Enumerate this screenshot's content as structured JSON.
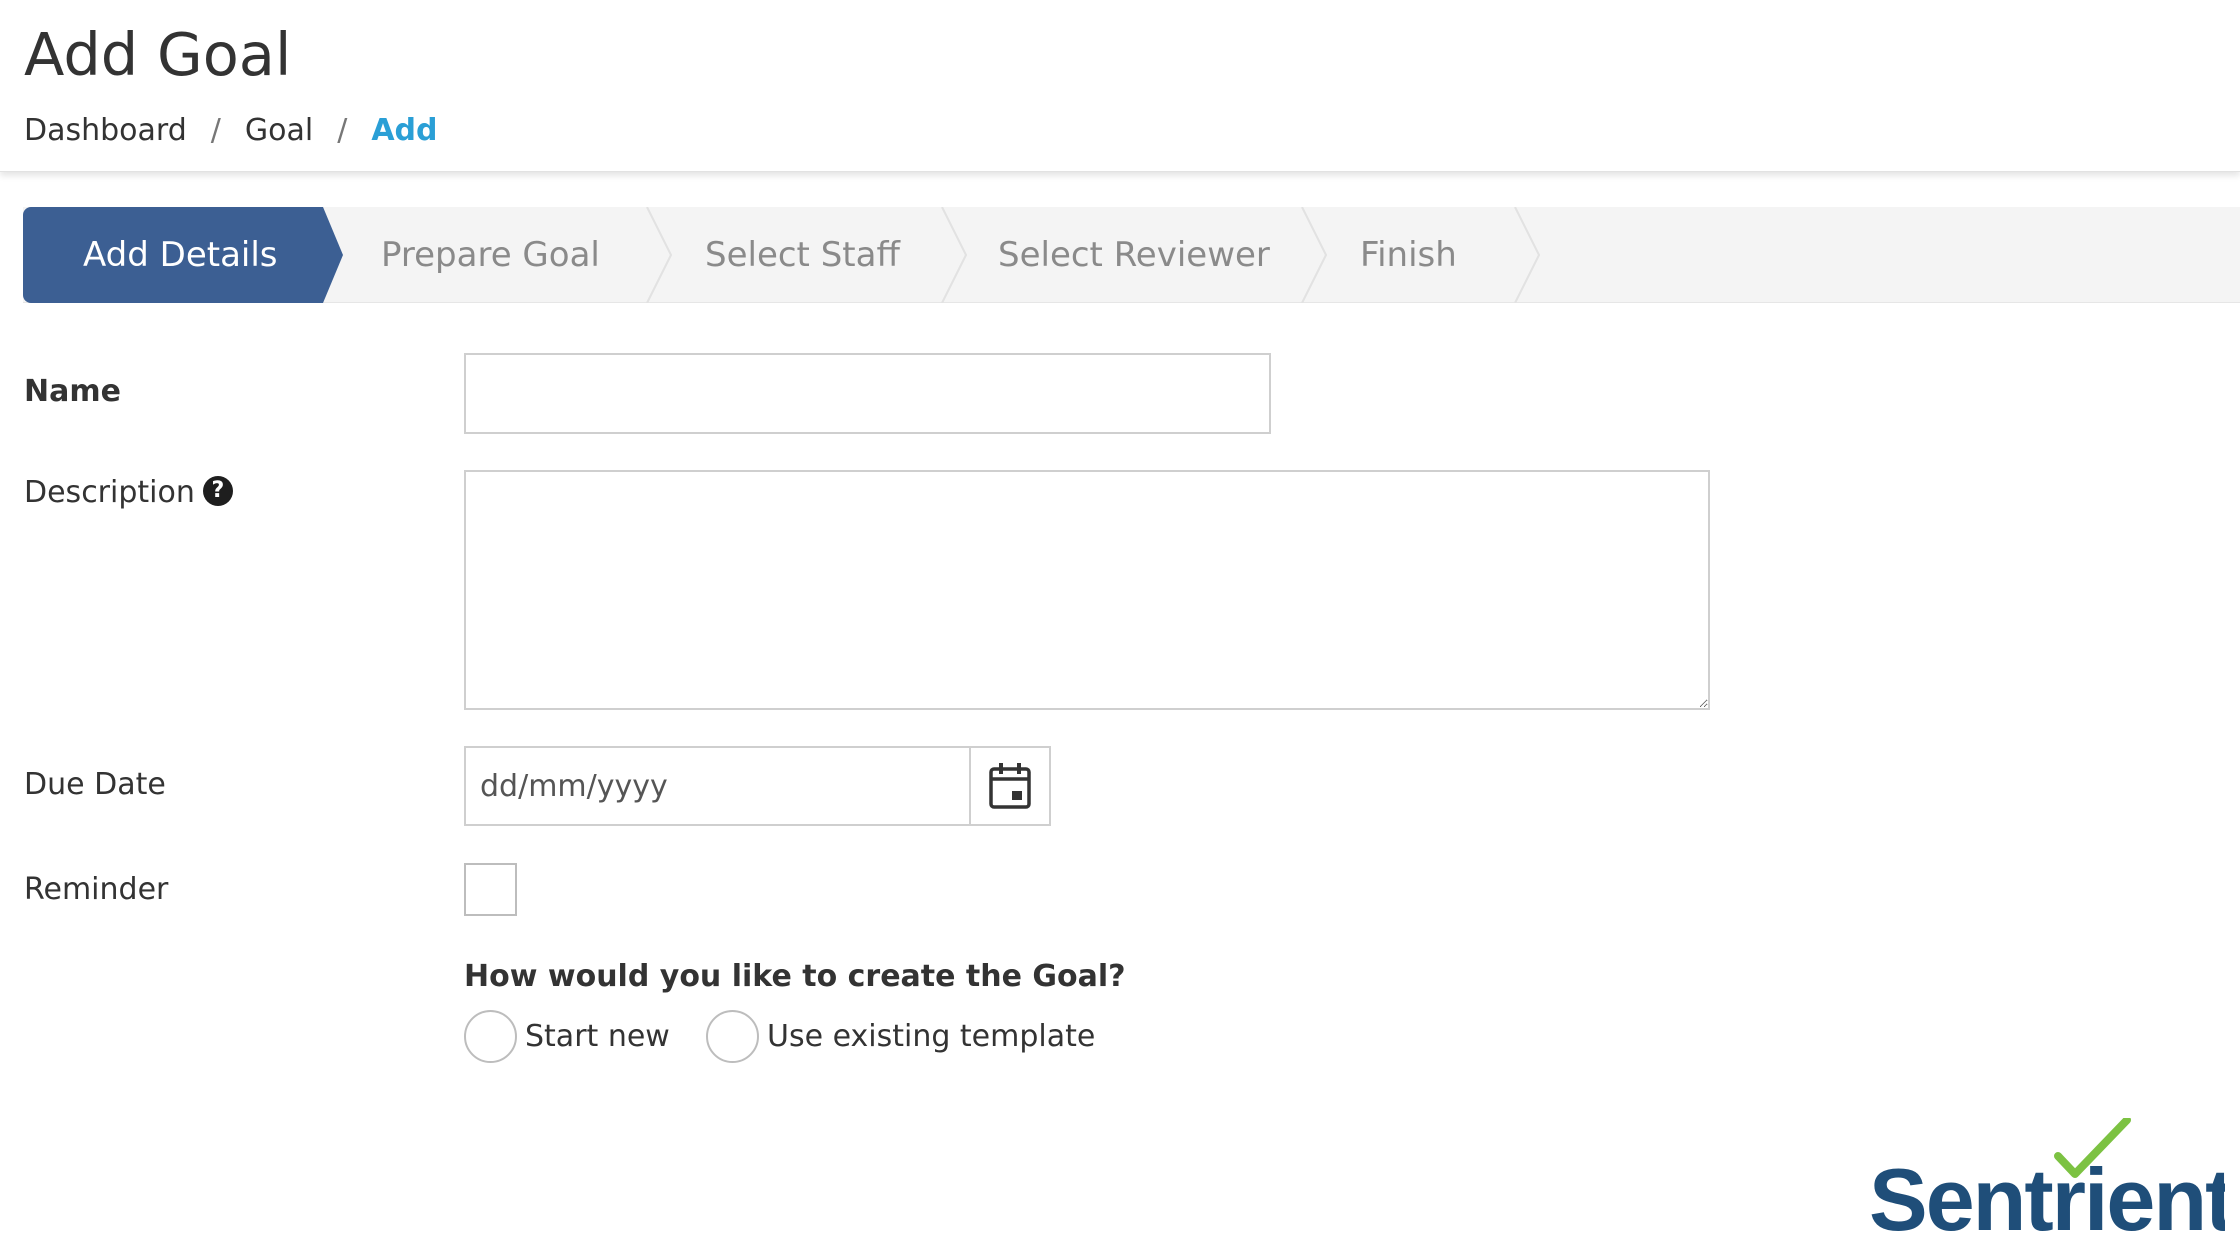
{
  "header": {
    "title": "Add Goal",
    "breadcrumb": [
      {
        "label": "Dashboard"
      },
      {
        "label": "Goal"
      },
      {
        "label": "Add"
      }
    ],
    "separator": "/"
  },
  "wizard": {
    "active_index": 0,
    "steps": [
      {
        "label": "Add Details"
      },
      {
        "label": "Prepare Goal"
      },
      {
        "label": "Select Staff"
      },
      {
        "label": "Select Reviewer"
      },
      {
        "label": "Finish"
      }
    ]
  },
  "form": {
    "name": {
      "label": "Name",
      "value": ""
    },
    "description": {
      "label": "Description",
      "help_icon": "?",
      "value": ""
    },
    "due_date": {
      "label": "Due Date",
      "placeholder": "dd/mm/yyyy",
      "value": ""
    },
    "reminder": {
      "label": "Reminder",
      "checked": false
    },
    "create_method": {
      "question": "How would you like to create the Goal?",
      "options": [
        {
          "label": "Start new",
          "selected": false
        },
        {
          "label": "Use existing template",
          "selected": false
        }
      ]
    }
  },
  "brand": {
    "logo_text": "Sentrient",
    "logo_color": "#1f4e79",
    "check_color": "#7cc242"
  },
  "colors": {
    "active_step": "#3c5f93",
    "breadcrumb_active": "#2a9fd6"
  }
}
